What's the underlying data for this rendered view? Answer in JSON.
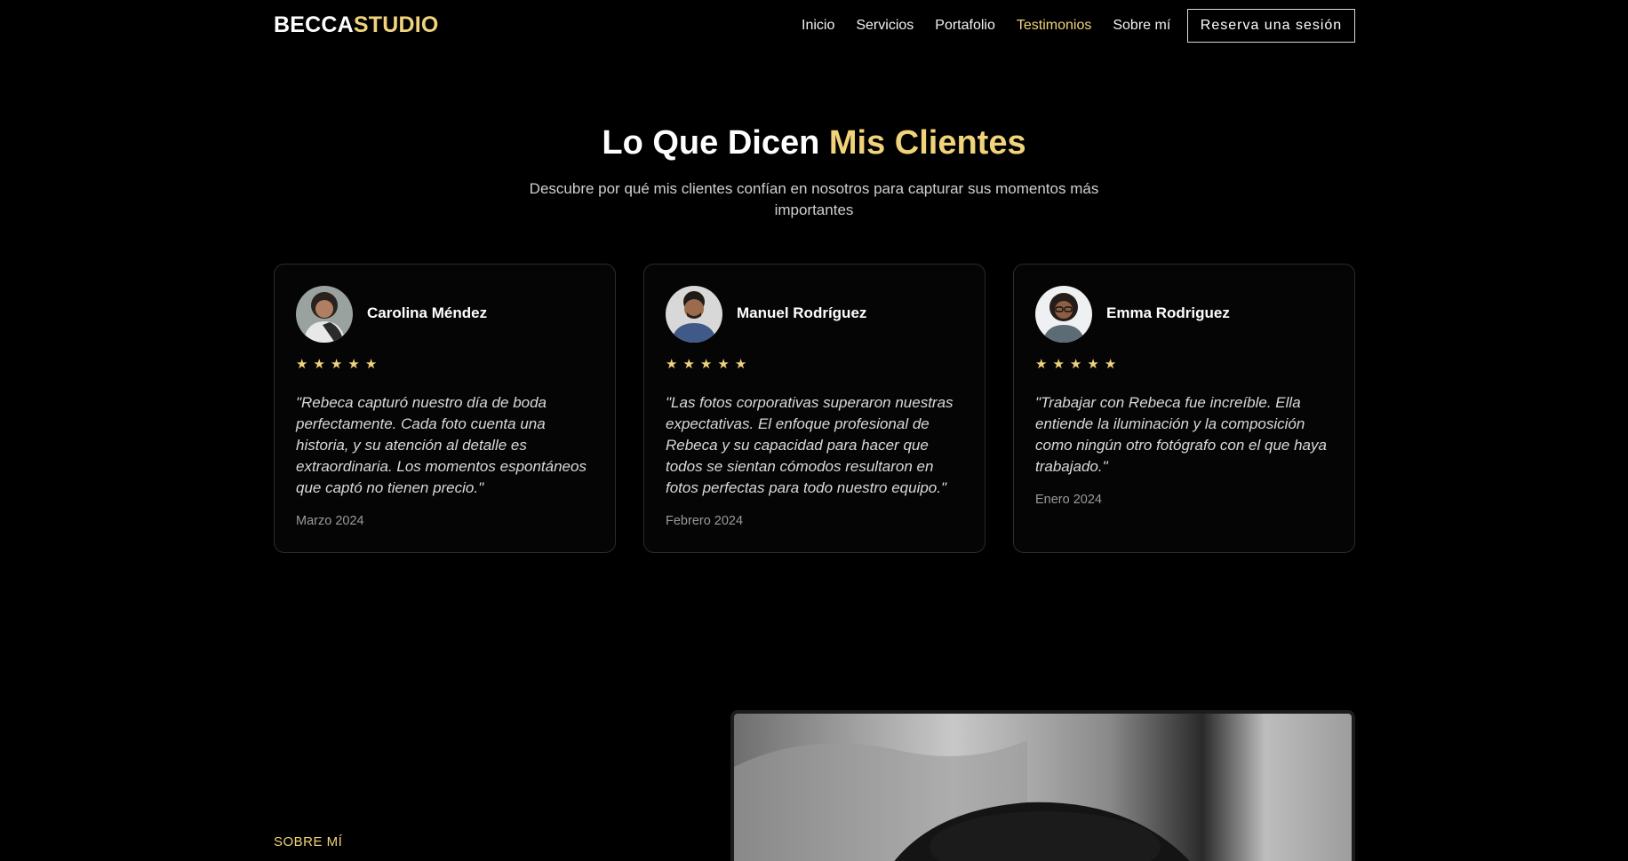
{
  "nav": {
    "brand_part1": "BECCA",
    "brand_part2": "STUDIO",
    "items": [
      {
        "label": "Inicio"
      },
      {
        "label": "Servicios"
      },
      {
        "label": "Portafolio"
      },
      {
        "label": "Testimonios"
      },
      {
        "label": "Sobre mí"
      }
    ],
    "active_item": "Testimonios",
    "cta_label": "Reserva una sesión"
  },
  "testimonials": {
    "title_part1": "Lo Que Dicen ",
    "title_highlight": "Mis Clientes",
    "subtitle": "Descubre por qué mis clientes confían en nosotros para capturar sus momentos más importantes",
    "star_glyph": "★",
    "cards": [
      {
        "name": "Carolina Méndez",
        "rating": 5,
        "quote": "\"Rebeca capturó nuestro día de boda perfectamente. Cada foto cuenta una historia, y su atención al detalle es extraordinaria. Los momentos espontáneos que captó no tienen precio.\"",
        "date": "Marzo 2024"
      },
      {
        "name": "Manuel Rodríguez",
        "rating": 5,
        "quote": "\"Las fotos corporativas superaron nuestras expectativas. El enfoque profesional de Rebeca y su capacidad para hacer que todos se sientan cómodos resultaron en fotos perfectas para todo nuestro equipo.\"",
        "date": "Febrero 2024"
      },
      {
        "name": "Emma Rodriguez",
        "rating": 5,
        "quote": "\"Trabajar con Rebeca fue increíble. Ella entiende la iluminación y la composición como ningún otro fotógrafo con el que haya trabajado.\"",
        "date": "Enero 2024"
      }
    ]
  },
  "about": {
    "label": "SOBRE MÍ"
  },
  "colors": {
    "accent": "#f0d37a",
    "background": "#000000",
    "card_border": "#2b2b2b"
  }
}
